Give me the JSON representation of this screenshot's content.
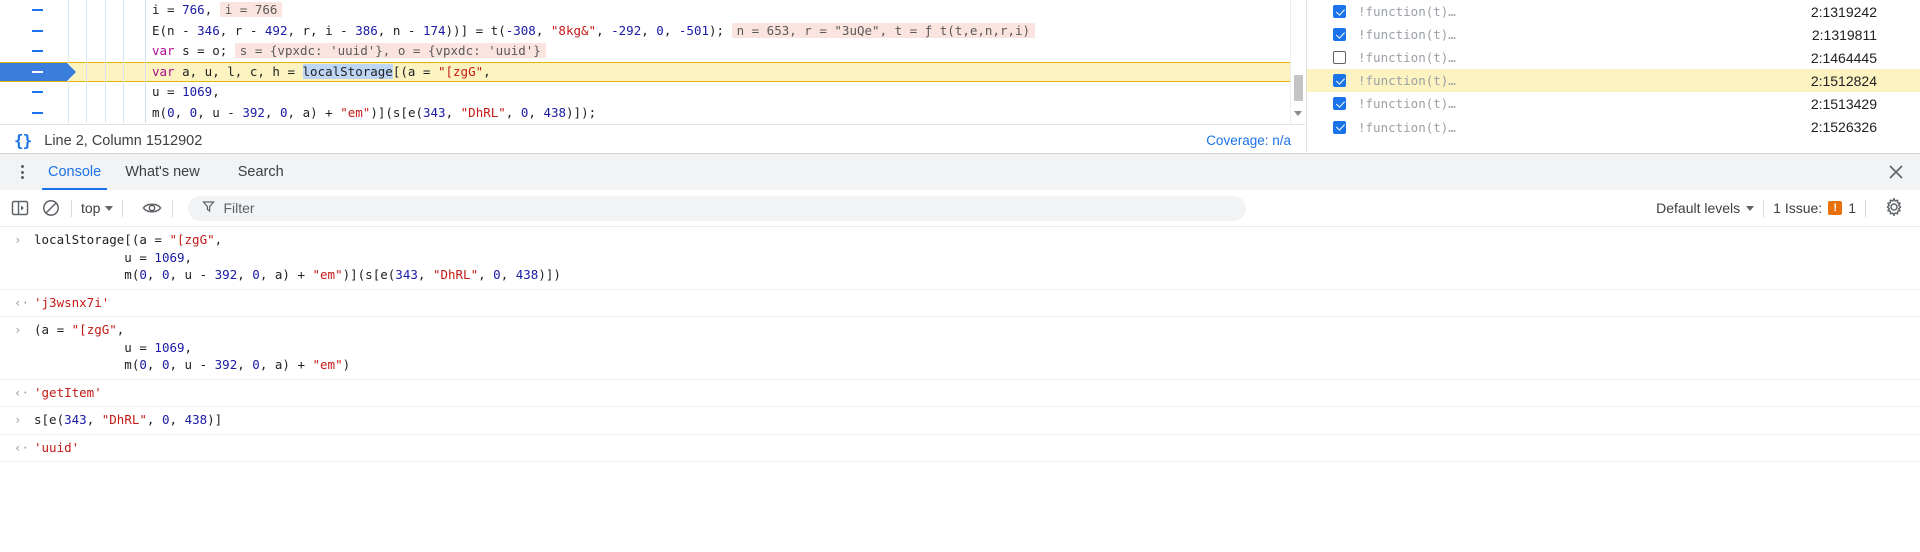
{
  "sources": {
    "code_lines": [
      {
        "gutter_dash": true,
        "executing": false,
        "segments": [
          {
            "t": "plain",
            "v": "          i = "
          },
          {
            "t": "num",
            "v": "766"
          },
          {
            "t": "plain",
            "v": ", "
          },
          {
            "t": "inline",
            "v": "i = 766"
          }
        ]
      },
      {
        "gutter_dash": true,
        "executing": false,
        "segments": [
          {
            "t": "plain",
            "v": "          E(n - "
          },
          {
            "t": "num",
            "v": "346"
          },
          {
            "t": "plain",
            "v": ", r - "
          },
          {
            "t": "num",
            "v": "492"
          },
          {
            "t": "plain",
            "v": ", r, i - "
          },
          {
            "t": "num",
            "v": "386"
          },
          {
            "t": "plain",
            "v": ", n - "
          },
          {
            "t": "num",
            "v": "174"
          },
          {
            "t": "plain",
            "v": "))] = t("
          },
          {
            "t": "num",
            "v": "-308"
          },
          {
            "t": "plain",
            "v": ", "
          },
          {
            "t": "str",
            "v": "\"8kg&\""
          },
          {
            "t": "plain",
            "v": ", "
          },
          {
            "t": "num",
            "v": "-292"
          },
          {
            "t": "plain",
            "v": ", "
          },
          {
            "t": "num",
            "v": "0"
          },
          {
            "t": "plain",
            "v": ", "
          },
          {
            "t": "num",
            "v": "-501"
          },
          {
            "t": "plain",
            "v": ");  "
          },
          {
            "t": "inline",
            "v": "n = 653, r = \"3uQe\", t = ƒ t(t,e,n,r,i)"
          }
        ]
      },
      {
        "gutter_dash": true,
        "executing": false,
        "segments": [
          {
            "t": "kw",
            "v": "          var"
          },
          {
            "t": "plain",
            "v": " s = o;  "
          },
          {
            "t": "inline",
            "v": "s = {vpxdc: 'uuid'}, o = {vpxdc: 'uuid'}"
          }
        ]
      },
      {
        "gutter_dash": true,
        "executing": true,
        "segments": [
          {
            "t": "kw",
            "v": "          var"
          },
          {
            "t": "plain",
            "v": " a, u, l, c, h = "
          },
          {
            "t": "sel",
            "v": "localStorage"
          },
          {
            "t": "plain",
            "v": "[(a = "
          },
          {
            "t": "str",
            "v": "\"[zgG\""
          },
          {
            "t": "plain",
            "v": ","
          }
        ]
      },
      {
        "gutter_dash": true,
        "executing": false,
        "segments": [
          {
            "t": "plain",
            "v": "          u = "
          },
          {
            "t": "num",
            "v": "1069"
          },
          {
            "t": "plain",
            "v": ","
          }
        ]
      },
      {
        "gutter_dash": true,
        "executing": false,
        "segments": [
          {
            "t": "plain",
            "v": "          m("
          },
          {
            "t": "num",
            "v": "0"
          },
          {
            "t": "plain",
            "v": ", "
          },
          {
            "t": "num",
            "v": "0"
          },
          {
            "t": "plain",
            "v": ", u - "
          },
          {
            "t": "num",
            "v": "392"
          },
          {
            "t": "plain",
            "v": ", "
          },
          {
            "t": "num",
            "v": "0"
          },
          {
            "t": "plain",
            "v": ", a) + "
          },
          {
            "t": "str",
            "v": "\"em\""
          },
          {
            "t": "plain",
            "v": ")](s[e("
          },
          {
            "t": "num",
            "v": "343"
          },
          {
            "t": "plain",
            "v": ", "
          },
          {
            "t": "str",
            "v": "\"DhRL\""
          },
          {
            "t": "plain",
            "v": ", "
          },
          {
            "t": "num",
            "v": "0"
          },
          {
            "t": "plain",
            "v": ", "
          },
          {
            "t": "num",
            "v": "438"
          },
          {
            "t": "plain",
            "v": ")]);"
          }
        ]
      }
    ],
    "status": {
      "format_icon": "{}",
      "cursor_position": "Line 2, Column 1512902",
      "coverage": "Coverage: n/a"
    }
  },
  "breakpoints": {
    "rows": [
      {
        "checked": true,
        "label": "!function(t)…",
        "location": "2:1319242",
        "highlight": false
      },
      {
        "checked": true,
        "label": "!function(t)…",
        "location": "2:1319811",
        "highlight": false
      },
      {
        "checked": false,
        "label": "!function(t)…",
        "location": "2:1464445",
        "highlight": false
      },
      {
        "checked": true,
        "label": "!function(t)…",
        "location": "2:1512824",
        "highlight": true
      },
      {
        "checked": true,
        "label": "!function(t)…",
        "location": "2:1513429",
        "highlight": false
      },
      {
        "checked": true,
        "label": "!function(t)…",
        "location": "2:1526326",
        "highlight": false
      }
    ]
  },
  "drawer": {
    "tabs": [
      {
        "label": "Console",
        "active": true
      },
      {
        "label": "What's new",
        "active": false
      },
      {
        "label": "Search",
        "active": false
      }
    ],
    "close_label": "✕"
  },
  "console_toolbar": {
    "sidebar_toggle": "show-console-sidebar-icon",
    "clear_label": "clear-console-icon",
    "context": "top",
    "eye_label": "live-expression-icon",
    "filter_placeholder": "Filter",
    "levels": "Default levels",
    "issues_text": "1 Issue:",
    "issues_count": "1",
    "settings_label": "settings-gear-icon"
  },
  "console_messages": [
    {
      "kind": "input",
      "marker": "›",
      "lines": [
        [
          {
            "t": "plain",
            "v": "localStorage[(a = "
          },
          {
            "t": "str",
            "v": "\"[zgG\""
          },
          {
            "t": "plain",
            "v": ","
          }
        ],
        [
          {
            "t": "plain",
            "v": "            u = "
          },
          {
            "t": "num",
            "v": "1069"
          },
          {
            "t": "plain",
            "v": ","
          }
        ],
        [
          {
            "t": "plain",
            "v": "            m("
          },
          {
            "t": "num",
            "v": "0"
          },
          {
            "t": "plain",
            "v": ", "
          },
          {
            "t": "num",
            "v": "0"
          },
          {
            "t": "plain",
            "v": ", u - "
          },
          {
            "t": "num",
            "v": "392"
          },
          {
            "t": "plain",
            "v": ", "
          },
          {
            "t": "num",
            "v": "0"
          },
          {
            "t": "plain",
            "v": ", a) + "
          },
          {
            "t": "str",
            "v": "\"em\""
          },
          {
            "t": "plain",
            "v": ")](s[e("
          },
          {
            "t": "num",
            "v": "343"
          },
          {
            "t": "plain",
            "v": ", "
          },
          {
            "t": "str",
            "v": "\"DhRL\""
          },
          {
            "t": "plain",
            "v": ", "
          },
          {
            "t": "num",
            "v": "0"
          },
          {
            "t": "plain",
            "v": ", "
          },
          {
            "t": "num",
            "v": "438"
          },
          {
            "t": "plain",
            "v": ")])"
          }
        ]
      ]
    },
    {
      "kind": "output",
      "marker": "‹·",
      "lines": [
        [
          {
            "t": "str",
            "v": "'j3wsnx7i'"
          }
        ]
      ]
    },
    {
      "kind": "input",
      "marker": "›",
      "lines": [
        [
          {
            "t": "plain",
            "v": "(a = "
          },
          {
            "t": "str",
            "v": "\"[zgG\""
          },
          {
            "t": "plain",
            "v": ","
          }
        ],
        [
          {
            "t": "plain",
            "v": "            u = "
          },
          {
            "t": "num",
            "v": "1069"
          },
          {
            "t": "plain",
            "v": ","
          }
        ],
        [
          {
            "t": "plain",
            "v": "            m("
          },
          {
            "t": "num",
            "v": "0"
          },
          {
            "t": "plain",
            "v": ", "
          },
          {
            "t": "num",
            "v": "0"
          },
          {
            "t": "plain",
            "v": ", u - "
          },
          {
            "t": "num",
            "v": "392"
          },
          {
            "t": "plain",
            "v": ", "
          },
          {
            "t": "num",
            "v": "0"
          },
          {
            "t": "plain",
            "v": ", a) + "
          },
          {
            "t": "str",
            "v": "\"em\""
          },
          {
            "t": "plain",
            "v": ")"
          }
        ]
      ]
    },
    {
      "kind": "output",
      "marker": "‹·",
      "lines": [
        [
          {
            "t": "str",
            "v": "'getItem'"
          }
        ]
      ]
    },
    {
      "kind": "input",
      "marker": "›",
      "lines": [
        [
          {
            "t": "plain",
            "v": "s[e("
          },
          {
            "t": "num",
            "v": "343"
          },
          {
            "t": "plain",
            "v": ", "
          },
          {
            "t": "str",
            "v": "\"DhRL\""
          },
          {
            "t": "plain",
            "v": ", "
          },
          {
            "t": "num",
            "v": "0"
          },
          {
            "t": "plain",
            "v": ", "
          },
          {
            "t": "num",
            "v": "438"
          },
          {
            "t": "plain",
            "v": ")]"
          }
        ]
      ]
    },
    {
      "kind": "output",
      "marker": "‹·",
      "lines": [
        [
          {
            "t": "str",
            "v": "'uuid'"
          }
        ]
      ]
    }
  ],
  "colors": {
    "accent": "#1a73e8",
    "exec_line": "#fcf3c0",
    "exec_border": "#e2b600",
    "inline_value_bg": "#fbe4df",
    "selection": "#bdd6f5",
    "string": "#c41a16",
    "number": "#1a1aa6",
    "keyword": "#aa0d91",
    "issue": "#e8710a"
  }
}
